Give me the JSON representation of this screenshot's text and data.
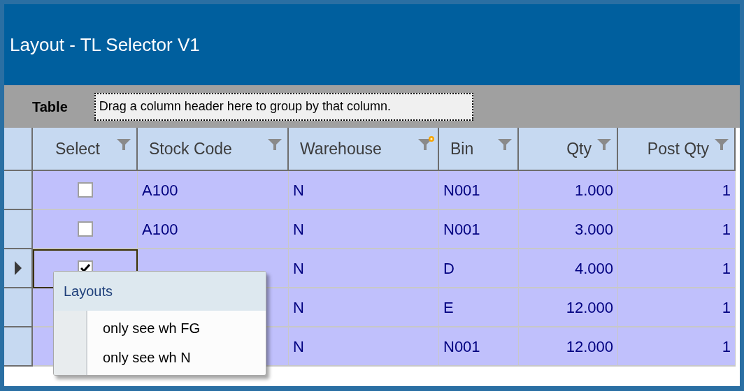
{
  "window": {
    "title": "Layout - TL Selector V1"
  },
  "group_panel": {
    "label": "Table",
    "hint": "Drag a column header here to group by that column."
  },
  "table": {
    "columns": [
      {
        "label": "Select",
        "kind": "checkbox",
        "filter_active": false
      },
      {
        "label": "Stock Code",
        "kind": "text",
        "filter_active": false
      },
      {
        "label": "Warehouse",
        "kind": "text",
        "filter_active": true
      },
      {
        "label": "Bin",
        "kind": "text",
        "filter_active": false
      },
      {
        "label": "Qty",
        "kind": "number",
        "filter_active": false
      },
      {
        "label": "Post Qty",
        "kind": "number",
        "filter_active": false
      }
    ],
    "rows": [
      {
        "selected": false,
        "checked": false,
        "stock_code": "A100",
        "warehouse": "N",
        "bin": "N001",
        "qty": "1.000",
        "post_qty": "1"
      },
      {
        "selected": false,
        "checked": false,
        "stock_code": "A100",
        "warehouse": "N",
        "bin": "N001",
        "qty": "3.000",
        "post_qty": "1"
      },
      {
        "selected": true,
        "checked": true,
        "warehouse": "N",
        "bin": "D",
        "qty": "4.000",
        "post_qty": "1"
      },
      {
        "selected": false,
        "warehouse": "N",
        "bin": "E",
        "qty": "12.000",
        "post_qty": "1"
      },
      {
        "selected": false,
        "warehouse": "N",
        "bin": "N001",
        "qty": "12.000",
        "post_qty": "1"
      }
    ]
  },
  "context_menu": {
    "title": "Layouts",
    "items": [
      "only see wh FG",
      "only see wh N"
    ]
  }
}
